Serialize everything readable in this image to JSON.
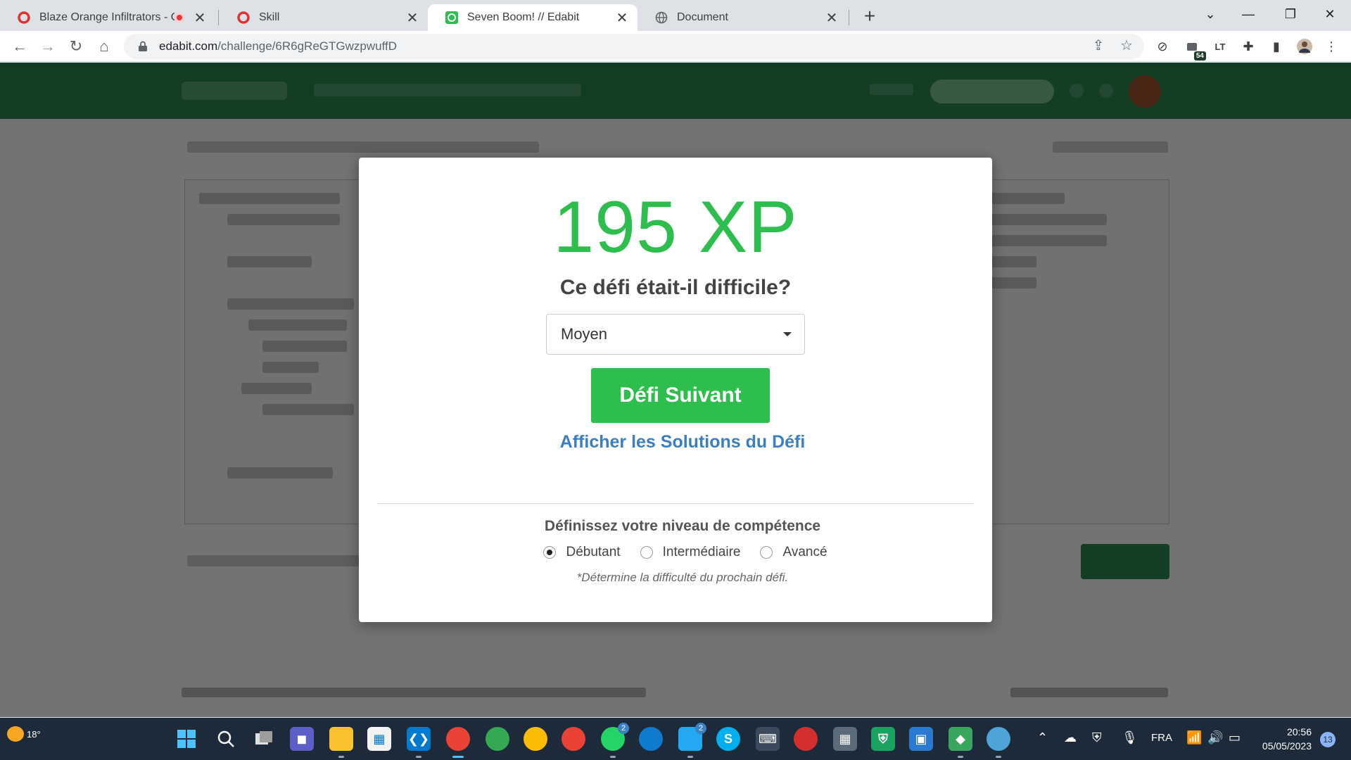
{
  "browser": {
    "tabs": [
      {
        "title": "Blaze Orange Infiltrators - O",
        "icon": "opera-icon"
      },
      {
        "title": "Skill",
        "icon": "opera-icon"
      },
      {
        "title": "Seven Boom! // Edabit",
        "icon": "edabit-icon",
        "active": true
      },
      {
        "title": "Document",
        "icon": "globe-icon"
      }
    ],
    "close_glyph": "✕",
    "new_tab_glyph": "+",
    "url_host": "edabit.com",
    "url_path": "/challenge/6R6gReGTGwzpwuffD",
    "extension_badge": "54"
  },
  "modal": {
    "xp": "195 XP",
    "question": "Ce défi était-il difficile?",
    "difficulty_selected": "Moyen",
    "next_button": "Défi Suivant",
    "solutions_link": "Afficher les Solutions du Défi",
    "skill_title": "Définissez votre niveau de compétence",
    "skill_options": [
      {
        "label": "Débutant",
        "checked": true
      },
      {
        "label": "Intermédiaire",
        "checked": false
      },
      {
        "label": "Avancé",
        "checked": false
      }
    ],
    "skill_note": "*Détermine la difficulté du prochain défi."
  },
  "taskbar": {
    "temperature": "18°",
    "whatsapp_badge": "2",
    "vscode_badge": "2",
    "language": "FRA",
    "time": "20:56",
    "date": "05/05/2023",
    "notifications": "13"
  },
  "colors": {
    "accent_green": "#2dbe4e",
    "link_blue": "#3a7fc1",
    "site_header_green": "#2d8a4e",
    "taskbar_bg": "#1c2a3a"
  }
}
